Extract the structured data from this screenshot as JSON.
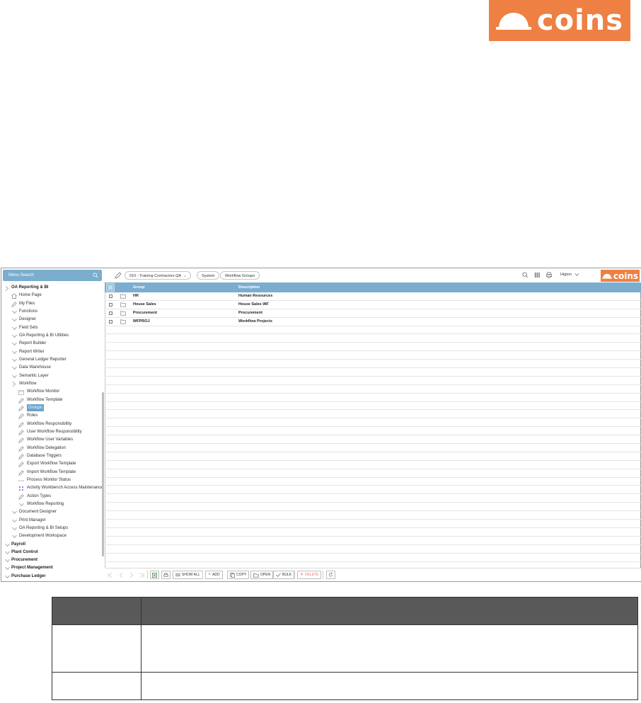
{
  "brand": {
    "logo_text": "coins",
    "accent_color": "#ee8043",
    "header_blue": "#7aadce"
  },
  "sidebar": {
    "search_placeholder": "Menu Search",
    "search_icon": "search-icon",
    "items": [
      {
        "label": "OA Reporting & BI",
        "level": 0,
        "icon": "chevron-right-icon",
        "bold": true
      },
      {
        "label": "Home Page",
        "level": 1,
        "icon": "home-icon"
      },
      {
        "label": "My Files",
        "level": 1,
        "icon": "pencil-icon"
      },
      {
        "label": "Functions",
        "level": 1,
        "icon": "chevron-down-icon"
      },
      {
        "label": "Designer",
        "level": 1,
        "icon": "chevron-down-icon"
      },
      {
        "label": "Field Sets",
        "level": 1,
        "icon": "chevron-down-icon"
      },
      {
        "label": "OA Reporting & BI Utilities",
        "level": 1,
        "icon": "chevron-down-icon"
      },
      {
        "label": "Report Builder",
        "level": 1,
        "icon": "chevron-down-icon"
      },
      {
        "label": "Report Writer",
        "level": 1,
        "icon": "chevron-down-icon"
      },
      {
        "label": "General Ledger Reporter",
        "level": 1,
        "icon": "chevron-down-icon"
      },
      {
        "label": "Data Warehouse",
        "level": 1,
        "icon": "chevron-down-icon"
      },
      {
        "label": "Semantic Layer",
        "level": 1,
        "icon": "chevron-down-icon"
      },
      {
        "label": "Workflow",
        "level": 1,
        "icon": "chevron-right-icon"
      },
      {
        "label": "Workflow Monitor",
        "level": 2,
        "icon": "window-icon"
      },
      {
        "label": "Workflow Template",
        "level": 2,
        "icon": "pencil-icon"
      },
      {
        "label": "Groups",
        "level": 2,
        "icon": "pencil-icon",
        "selected": true
      },
      {
        "label": "Roles",
        "level": 2,
        "icon": "pencil-icon"
      },
      {
        "label": "Workflow Responsibility",
        "level": 2,
        "icon": "pencil-icon"
      },
      {
        "label": "User Workflow Responsibility",
        "level": 2,
        "icon": "pencil-icon"
      },
      {
        "label": "Workflow User Variables",
        "level": 2,
        "icon": "pencil-icon"
      },
      {
        "label": "Workflow Delegation",
        "level": 2,
        "icon": "pencil-icon"
      },
      {
        "label": "Database Triggers",
        "level": 2,
        "icon": "pencil-icon"
      },
      {
        "label": "Export Workflow Template",
        "level": 2,
        "icon": "pencil-icon"
      },
      {
        "label": "Import Workflow Template",
        "level": 2,
        "icon": "pencil-icon"
      },
      {
        "label": "Process Monitor Status",
        "level": 2,
        "icon": "dots-icon"
      },
      {
        "label": "Activity Workbench Access Maintenance",
        "level": 2,
        "icon": "grid-icon"
      },
      {
        "label": "Action Types",
        "level": 2,
        "icon": "pencil-icon"
      },
      {
        "label": "Workflow Reporting",
        "level": 2,
        "icon": "chevron-down-icon"
      },
      {
        "label": "Document Designer",
        "level": 1,
        "icon": "chevron-down-icon"
      },
      {
        "label": "Print Manager",
        "level": 1,
        "icon": "chevron-down-icon"
      },
      {
        "label": "OA Reporting & BI Setups",
        "level": 1,
        "icon": "chevron-down-icon"
      },
      {
        "label": "Development Workspace",
        "level": 1,
        "icon": "chevron-down-icon"
      },
      {
        "label": "Payroll",
        "level": 0,
        "icon": "chevron-down-icon",
        "bold": true
      },
      {
        "label": "Plant Control",
        "level": 0,
        "icon": "chevron-down-icon",
        "bold": true
      },
      {
        "label": "Procurement",
        "level": 0,
        "icon": "chevron-down-icon",
        "bold": true
      },
      {
        "label": "Project Management",
        "level": 0,
        "icon": "chevron-down-icon",
        "bold": true
      },
      {
        "label": "Purchase Ledger",
        "level": 0,
        "icon": "chevron-down-icon",
        "bold": true
      }
    ]
  },
  "topbar": {
    "company": "010 - Training Contractors QA",
    "crumb_system": "System",
    "crumb_page": "Workflow Groups",
    "user": "Higton"
  },
  "grid": {
    "columns": [
      "Group",
      "Description"
    ],
    "rows": [
      {
        "group": "HR",
        "description": "Human Resources"
      },
      {
        "group": "House Sales",
        "description": "House Sales WF"
      },
      {
        "group": "Procurement",
        "description": "Procurement"
      },
      {
        "group": "WFPROJ",
        "description": "Workflow Projects"
      }
    ]
  },
  "toolbar": {
    "show_all": "SHOW ALL",
    "add": "ADD",
    "copy": "COPY",
    "open": "OPEN",
    "bulk": "BULK",
    "delete": "DELETE"
  }
}
